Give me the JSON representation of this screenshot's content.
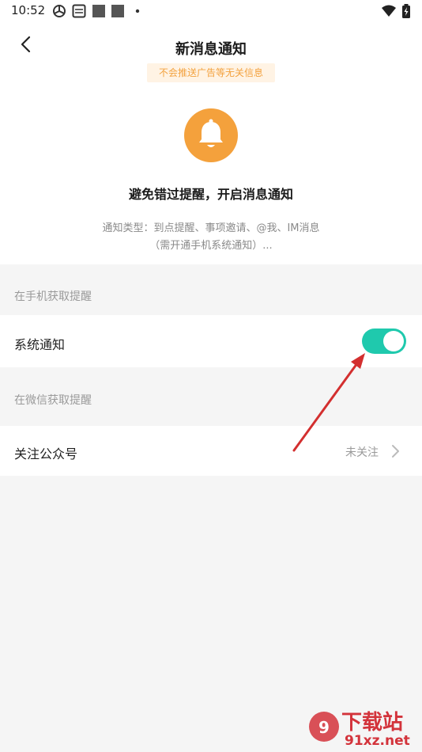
{
  "status_bar": {
    "time": "10:52"
  },
  "header": {
    "title": "新消息通知",
    "tag": "不会推送广告等无关信息"
  },
  "hero": {
    "headline": "避免错过提醒，开启消息通知",
    "desc_line1": "通知类型：到点提醒、事项邀请、@我、IM消息",
    "desc_line2": "（需开通手机系统通知）..."
  },
  "phone_section": {
    "title": "在手机获取提醒",
    "system_notify_label": "系统通知",
    "system_notify_on": true
  },
  "wechat_section": {
    "title": "在微信获取提醒",
    "follow_label": "关注公众号",
    "follow_status": "未关注"
  },
  "watermark": {
    "line1": "下载站",
    "line2": "91xz.net"
  },
  "colors": {
    "accent": "#1fc9ad",
    "bell": "#f4a13c",
    "tag_text": "#f3a23f",
    "arrow": "#d32f2f"
  }
}
